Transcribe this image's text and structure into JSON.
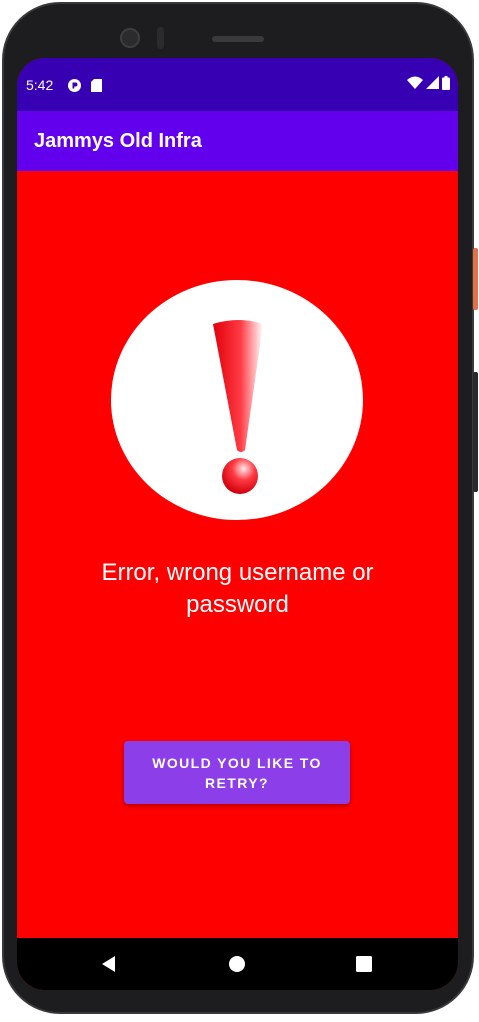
{
  "status_bar": {
    "time": "5:42",
    "left_icons": [
      "circle-app-icon",
      "sd-card-icon"
    ],
    "right_icons": [
      "wifi-icon",
      "signal-icon",
      "battery-icon"
    ]
  },
  "app_bar": {
    "title": "Jammys Old Infra"
  },
  "main": {
    "alert_icon": "exclamation-icon",
    "error_message": "Error, wrong username or password",
    "retry_button_label": "WOULD YOU LIKE TO RETRY?"
  },
  "nav_bar": {
    "buttons": [
      "back-icon",
      "home-icon",
      "recents-icon"
    ]
  },
  "colors": {
    "status_bar": "#3700b3",
    "app_bar": "#6200ee",
    "background": "#ff0000",
    "button": "#8c3ee8",
    "text": "#ffffff"
  }
}
